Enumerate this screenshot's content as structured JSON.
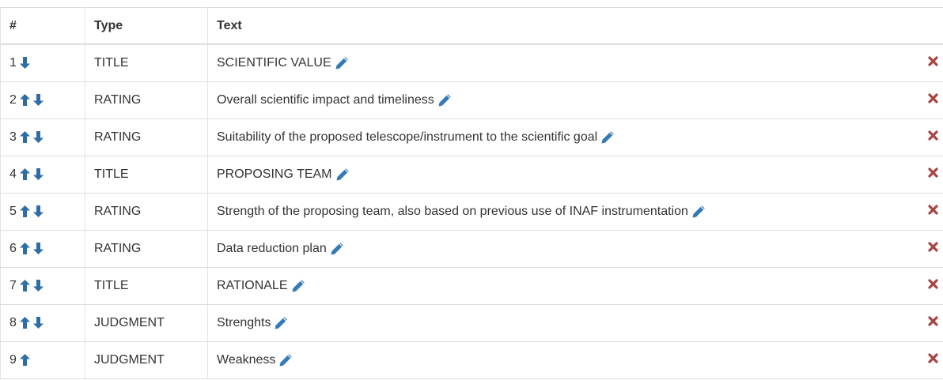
{
  "header": {
    "num": "#",
    "type": "Type",
    "text": "Text"
  },
  "colors": {
    "arrow": "#2e6da4",
    "edit": "#337ab7",
    "delete": "#a94442"
  },
  "rows": [
    {
      "num": "1",
      "type": "TITLE",
      "text": "SCIENTIFIC VALUE",
      "up": false,
      "down": true
    },
    {
      "num": "2",
      "type": "RATING",
      "text": "Overall scientific impact and timeliness",
      "up": true,
      "down": true
    },
    {
      "num": "3",
      "type": "RATING",
      "text": "Suitability of the proposed telescope/instrument to the scientific goal",
      "up": true,
      "down": true
    },
    {
      "num": "4",
      "type": "TITLE",
      "text": "PROPOSING TEAM",
      "up": true,
      "down": true
    },
    {
      "num": "5",
      "type": "RATING",
      "text": "Strength of the proposing team, also based on previous use of INAF instrumentation",
      "up": true,
      "down": true
    },
    {
      "num": "6",
      "type": "RATING",
      "text": "Data reduction plan",
      "up": true,
      "down": true
    },
    {
      "num": "7",
      "type": "TITLE",
      "text": "RATIONALE",
      "up": true,
      "down": true
    },
    {
      "num": "8",
      "type": "JUDGMENT",
      "text": "Strenghts",
      "up": true,
      "down": true
    },
    {
      "num": "9",
      "type": "JUDGMENT",
      "text": "Weakness",
      "up": true,
      "down": false
    }
  ]
}
